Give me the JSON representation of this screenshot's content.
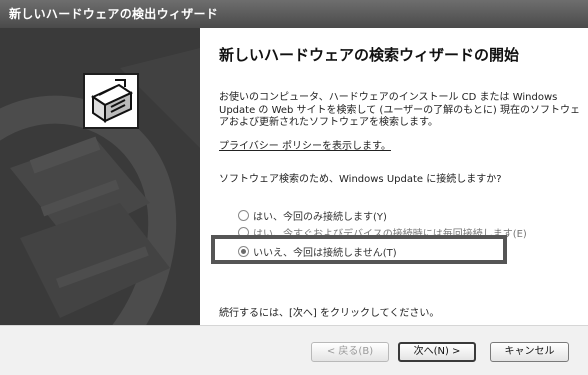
{
  "window": {
    "title": "新しいハードウェアの検出ウィザード"
  },
  "sidebar": {
    "icon": "hardware-device-icon"
  },
  "content": {
    "heading": "新しいハードウェアの検索ウィザードの開始",
    "intro": "お使いのコンピュータ、ハードウェアのインストール CD または Windows Update の Web サイトを検索して (ユーザーの了解のもとに) 現在のソフトウェアおよび更新されたソフトウェアを検索します。",
    "privacy_link": "プライバシー ポリシーを表示します。",
    "question": "ソフトウェア検索のため、Windows Update に接続しますか?",
    "options": [
      {
        "label": "はい、今回のみ接続します(Y)",
        "selected": false
      },
      {
        "label": "はい、今すぐおよびデバイスの接続時には毎回接続します(E)",
        "selected": false
      },
      {
        "label": "いいえ、今回は接続しません(T)",
        "selected": true
      }
    ],
    "footer": "続行するには、[次へ] をクリックしてください。"
  },
  "buttons": {
    "back": "< 戻る(B)",
    "next": "次へ(N) >",
    "cancel": "キャンセル"
  },
  "colors": {
    "titlebar": "#5a5a5a",
    "sidebar": "#3c3c3c",
    "highlight": "#555555"
  }
}
